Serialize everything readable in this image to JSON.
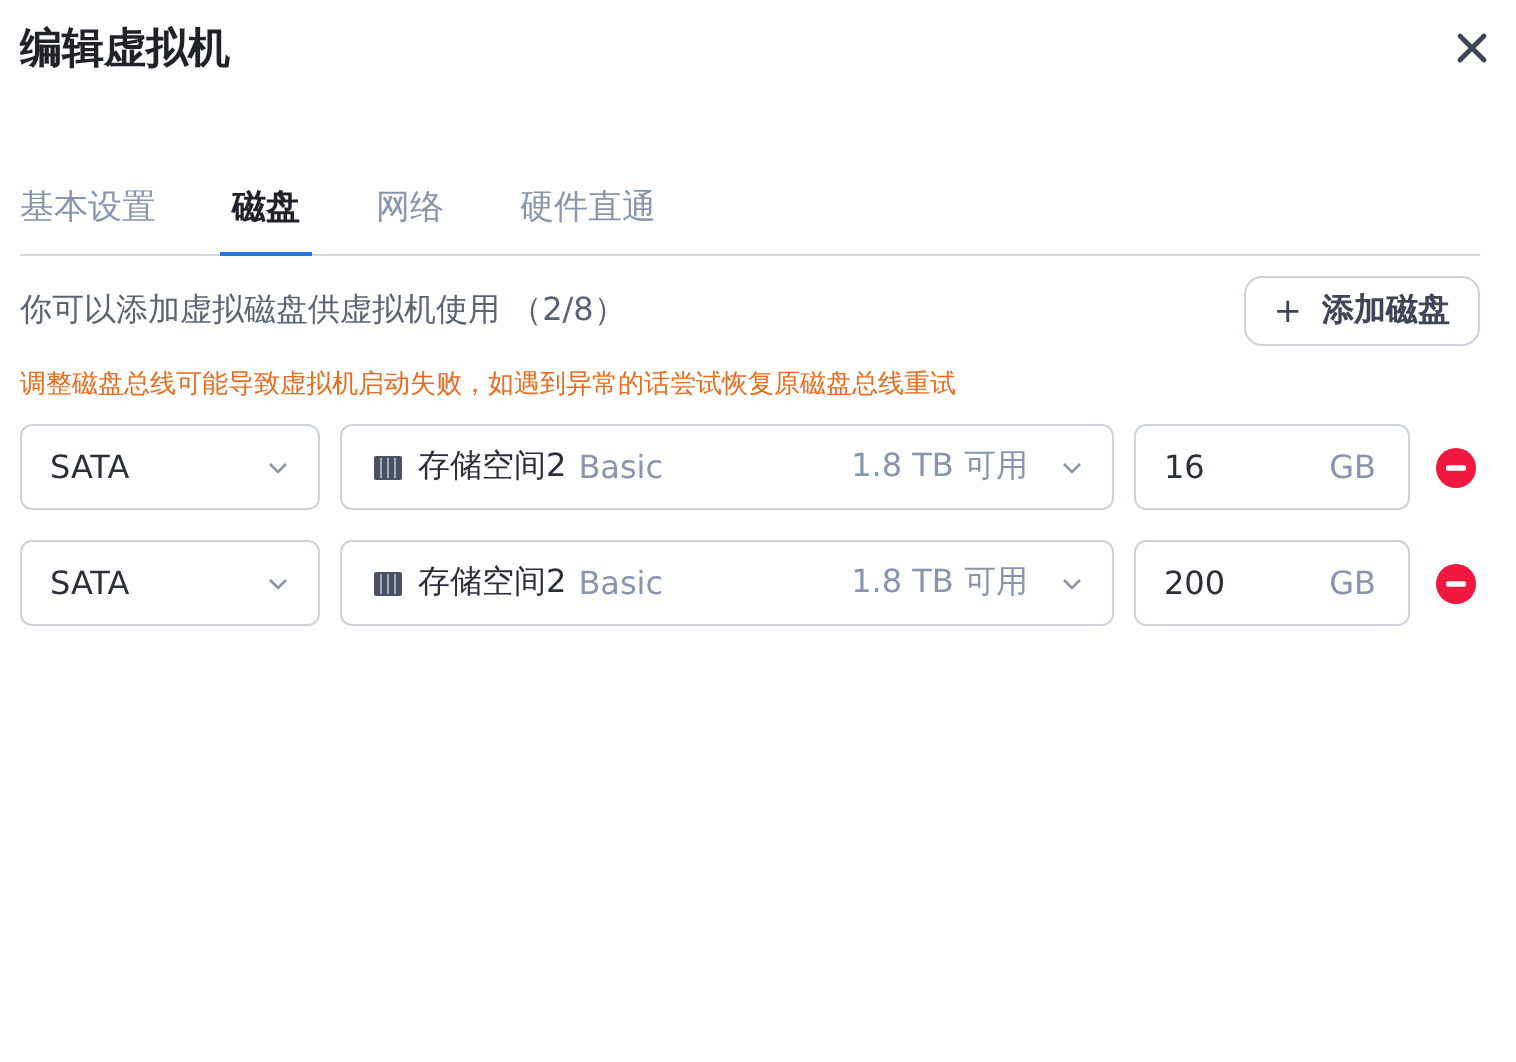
{
  "window": {
    "title": "编辑虚拟机"
  },
  "tabs": [
    {
      "label": "基本设置",
      "selected": false
    },
    {
      "label": "磁盘",
      "selected": true
    },
    {
      "label": "网络",
      "selected": false
    },
    {
      "label": "硬件直通",
      "selected": false
    }
  ],
  "info": "你可以添加虚拟磁盘供虚拟机使用 （2/8）",
  "add_button": {
    "icon": "+",
    "label": "添加磁盘"
  },
  "warning": "调整磁盘总线可能导致虚拟机启动失败，如遇到异常的话尝试恢复原磁盘总线重试",
  "disks": [
    {
      "bus": "SATA",
      "storage": "存储空间2",
      "storage_type": "Basic",
      "available": "1.8 TB 可用",
      "size": "16",
      "unit": "GB"
    },
    {
      "bus": "SATA",
      "storage": "存储空间2",
      "storage_type": "Basic",
      "available": "1.8 TB 可用",
      "size": "200",
      "unit": "GB"
    }
  ]
}
